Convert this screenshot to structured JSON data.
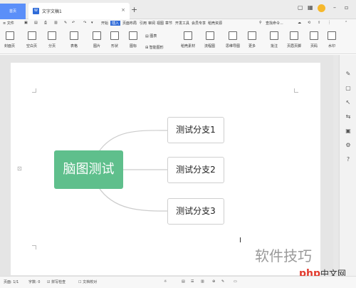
{
  "titlebar": {
    "home_tab": "首页",
    "doc_tab": "文字文稿1",
    "doc_icon": "W",
    "new_tab": "+"
  },
  "menubar": {
    "file": "≡ 文件",
    "items": [
      "开始",
      "插入",
      "页面布局",
      "引用",
      "审阅",
      "视图",
      "章节",
      "开发工具",
      "会员专享",
      "稻壳资源"
    ],
    "active_index": 1,
    "search": "查找命令..."
  },
  "ribbon": {
    "buttons": [
      {
        "label": "封面页"
      },
      {
        "label": "空白页"
      },
      {
        "label": "分页"
      },
      {
        "label": "表格"
      },
      {
        "label": "图片"
      },
      {
        "label": "形状"
      },
      {
        "label": "图标"
      },
      {
        "label": "稻壳素材"
      },
      {
        "label": "流程图"
      },
      {
        "label": "思维导图"
      },
      {
        "label": "更多"
      },
      {
        "label": "批注"
      },
      {
        "label": "页眉页脚"
      },
      {
        "label": "页码"
      },
      {
        "label": "水印"
      }
    ],
    "chart_label": "图表",
    "smart_label": "智能图形"
  },
  "mindmap": {
    "root": "脑图测试",
    "children": [
      "测试分支1",
      "测试分支2",
      "测试分支3"
    ]
  },
  "status": {
    "page": "页面: 1/1",
    "words": "字数: 0",
    "spell": "拼写检查",
    "proof": "文档校对"
  },
  "watermark": {
    "text": "软件技巧",
    "badge_main": "php",
    "badge_sub": "中文网"
  },
  "colors": {
    "root_node": "#5fbf8c",
    "accent": "#2f6bd8",
    "home_tab": "#5b8ff9"
  }
}
